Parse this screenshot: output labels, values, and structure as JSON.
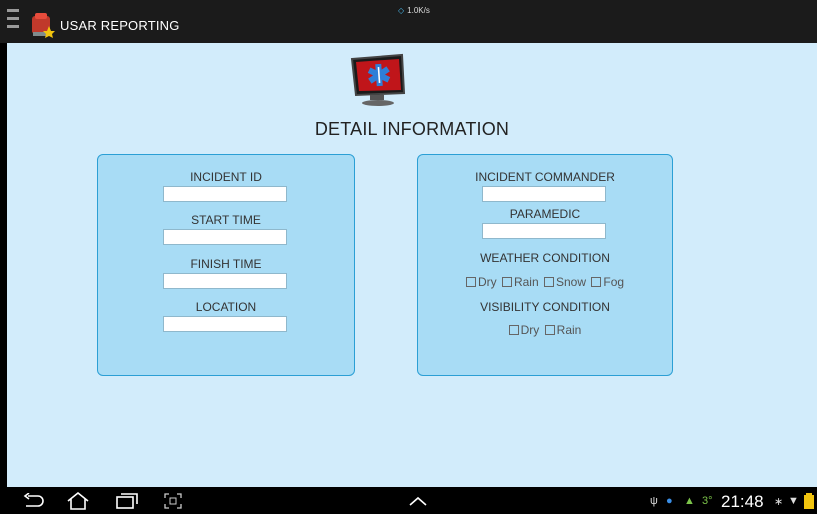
{
  "app": {
    "title": "USAR REPORTING",
    "network_speed": "1.0K/s"
  },
  "page": {
    "title": "DETAIL INFORMATION"
  },
  "left_panel": {
    "fields": [
      {
        "label": "INCIDENT ID",
        "value": "",
        "placeholder": ""
      },
      {
        "label": "START TIME",
        "value": "",
        "placeholder": ""
      },
      {
        "label": "FINISH TIME",
        "value": "",
        "placeholder": ""
      },
      {
        "label": "LOCATION",
        "value": "",
        "placeholder": ""
      }
    ]
  },
  "right_panel": {
    "fields": [
      {
        "label": "INCIDENT COMMANDER",
        "value": "",
        "placeholder": ""
      },
      {
        "label": "PARAMEDIC",
        "value": "",
        "placeholder": ""
      }
    ],
    "weather": {
      "label": "WEATHER CONDITION",
      "options": [
        "Dry",
        "Rain",
        "Snow",
        "Fog"
      ]
    },
    "visibility": {
      "label": "VISIBILITY CONDITION",
      "options": [
        "Dry",
        "Rain"
      ]
    }
  },
  "system_bar": {
    "time": "21:48",
    "battery_temp": "3°",
    "icons": [
      "back-icon",
      "home-icon",
      "recent-apps-icon",
      "screenshot-icon",
      "chevron-up-icon",
      "usb-icon",
      "notification-icon",
      "android-icon",
      "bluetooth-icon",
      "wifi-icon",
      "battery-icon"
    ]
  },
  "colors": {
    "background": "#d2ecfb",
    "panel": "#a8dcf5",
    "panel_border": "#2b9fd5",
    "topbar": "#1b1b1b"
  }
}
